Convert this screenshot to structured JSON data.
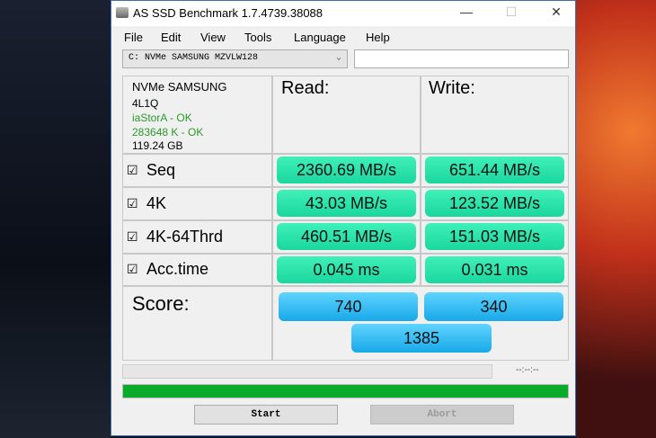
{
  "window": {
    "title": "AS SSD Benchmark 1.7.4739.38088",
    "minimize": "—",
    "maximize": "☐",
    "close": "✕"
  },
  "menu": [
    "File",
    "Edit",
    "View",
    "Tools",
    "Language",
    "Help"
  ],
  "drive_select": {
    "value": "C: NVMe SAMSUNG MZVLW128",
    "arrow": "⌄"
  },
  "drive_info": {
    "name": "NVMe SAMSUNG",
    "firmware": "4L1Q",
    "driver": "iaStorA - OK",
    "alignment": "283648 K - OK",
    "size": "119.24 GB"
  },
  "headers": {
    "read": "Read:",
    "write": "Write:"
  },
  "rows": [
    {
      "label": "Seq",
      "checked": "☑",
      "read": "2360.69 MB/s",
      "write": "651.44 MB/s"
    },
    {
      "label": "4K",
      "checked": "☑",
      "read": "43.03 MB/s",
      "write": "123.52 MB/s"
    },
    {
      "label": "4K-64Thrd",
      "checked": "☑",
      "read": "460.51 MB/s",
      "write": "151.03 MB/s"
    },
    {
      "label": "Acc.time",
      "checked": "☑",
      "read": "0.045 ms",
      "write": "0.031 ms"
    }
  ],
  "score": {
    "label": "Score:",
    "read": "740",
    "write": "340",
    "total": "1385"
  },
  "progress": {
    "time": "--:--:--",
    "complete_percent": 100
  },
  "buttons": {
    "start": "Start",
    "abort": "Abort"
  },
  "colors": {
    "ok": "#2a9a2a",
    "result": "#1ad79e",
    "score": "#18a8e8",
    "progress": "#0aaa2a"
  }
}
